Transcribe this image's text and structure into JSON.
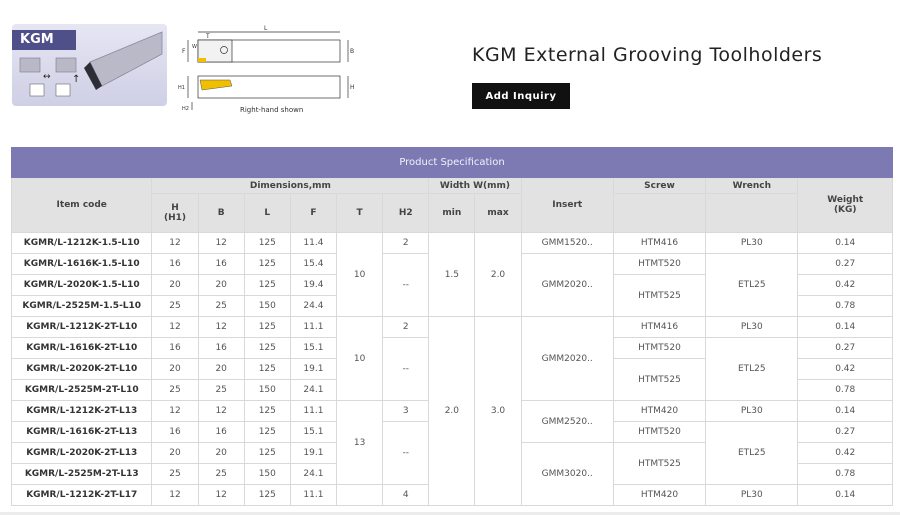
{
  "hero": {
    "badge": "KGM",
    "caption": "Right-hand shown",
    "dim_labels": [
      "L",
      "B",
      "F",
      "W",
      "T",
      "H",
      "H1",
      "H2"
    ]
  },
  "page": {
    "title": "KGM External Grooving Toolholders",
    "inquiry_label": "Add Inquiry"
  },
  "table": {
    "banner": "Product Specification",
    "headers": {
      "item_code": "Item code",
      "dimensions": "Dimensions,mm",
      "width": "Width W(mm)",
      "insert": "Insert",
      "screw": "Screw",
      "wrench": "Wrench",
      "weight": "Weight",
      "weight_unit": "(KG)",
      "h": "H",
      "h1": "(H1)",
      "b": "B",
      "l": "L",
      "f": "F",
      "t": "T",
      "h2": "H2",
      "min": "min",
      "max": "max"
    },
    "rows": [
      {
        "code": "KGMR/L-1212K-1.5-L10",
        "h": "12",
        "b": "12",
        "l": "125",
        "f": "11.4",
        "weight": "0.14"
      },
      {
        "code": "KGMR/L-1616K-1.5-L10",
        "h": "16",
        "b": "16",
        "l": "125",
        "f": "15.4",
        "weight": "0.27"
      },
      {
        "code": "KGMR/L-2020K-1.5-L10",
        "h": "20",
        "b": "20",
        "l": "125",
        "f": "19.4",
        "weight": "0.42"
      },
      {
        "code": "KGMR/L-2525M-1.5-L10",
        "h": "25",
        "b": "25",
        "l": "150",
        "f": "24.4",
        "weight": "0.78"
      },
      {
        "code": "KGMR/L-1212K-2T-L10",
        "h": "12",
        "b": "12",
        "l": "125",
        "f": "11.1",
        "weight": "0.14"
      },
      {
        "code": "KGMR/L-1616K-2T-L10",
        "h": "16",
        "b": "16",
        "l": "125",
        "f": "15.1",
        "weight": "0.27"
      },
      {
        "code": "KGMR/L-2020K-2T-L10",
        "h": "20",
        "b": "20",
        "l": "125",
        "f": "19.1",
        "weight": "0.42"
      },
      {
        "code": "KGMR/L-2525M-2T-L10",
        "h": "25",
        "b": "25",
        "l": "150",
        "f": "24.1",
        "weight": "0.78"
      },
      {
        "code": "KGMR/L-1212K-2T-L13",
        "h": "12",
        "b": "12",
        "l": "125",
        "f": "11.1",
        "weight": "0.14"
      },
      {
        "code": "KGMR/L-1616K-2T-L13",
        "h": "16",
        "b": "16",
        "l": "125",
        "f": "15.1",
        "weight": "0.27"
      },
      {
        "code": "KGMR/L-2020K-2T-L13",
        "h": "20",
        "b": "20",
        "l": "125",
        "f": "19.1",
        "weight": "0.42"
      },
      {
        "code": "KGMR/L-2525M-2T-L13",
        "h": "25",
        "b": "25",
        "l": "150",
        "f": "24.1",
        "weight": "0.78"
      },
      {
        "code": "KGMR/L-1212K-2T-L17",
        "h": "12",
        "b": "12",
        "l": "125",
        "f": "11.1",
        "weight": "0.14"
      }
    ],
    "merged": {
      "t_10a": "10",
      "t_10b": "10",
      "t_13": "13",
      "t_17": "",
      "h2_2a": "2",
      "h2_dash_a": "--",
      "h2_2b": "2",
      "h2_dash_b": "--",
      "h2_3": "3",
      "h2_dash_c": "--",
      "h2_4": "4",
      "min_15": "1.5",
      "max_20": "2.0",
      "min_20": "2.0",
      "max_30": "3.0",
      "insert_gmm1520": "GMM1520..",
      "insert_gmm2020a": "GMM2020..",
      "insert_gmm2020b": "GMM2020..",
      "insert_gmm2520": "GMM2520..",
      "insert_gmm3020": "GMM3020..",
      "screw_htm416a": "HTM416",
      "screw_htmt520a": "HTMT520",
      "screw_htmt525a": "HTMT525",
      "screw_htm416b": "HTM416",
      "screw_htmt520b": "HTMT520",
      "screw_htmt525b": "HTMT525",
      "screw_htm420a": "HTM420",
      "screw_htmt520c": "HTMT520",
      "screw_htmt525c": "HTMT525",
      "screw_htm420b": "HTM420",
      "wrench_pl30a": "PL30",
      "wrench_etl25a": "ETL25",
      "wrench_pl30b": "PL30",
      "wrench_etl25b": "ETL25",
      "wrench_pl30c": "PL30",
      "wrench_etl25c": "ETL25",
      "wrench_pl30d": "PL30"
    }
  }
}
